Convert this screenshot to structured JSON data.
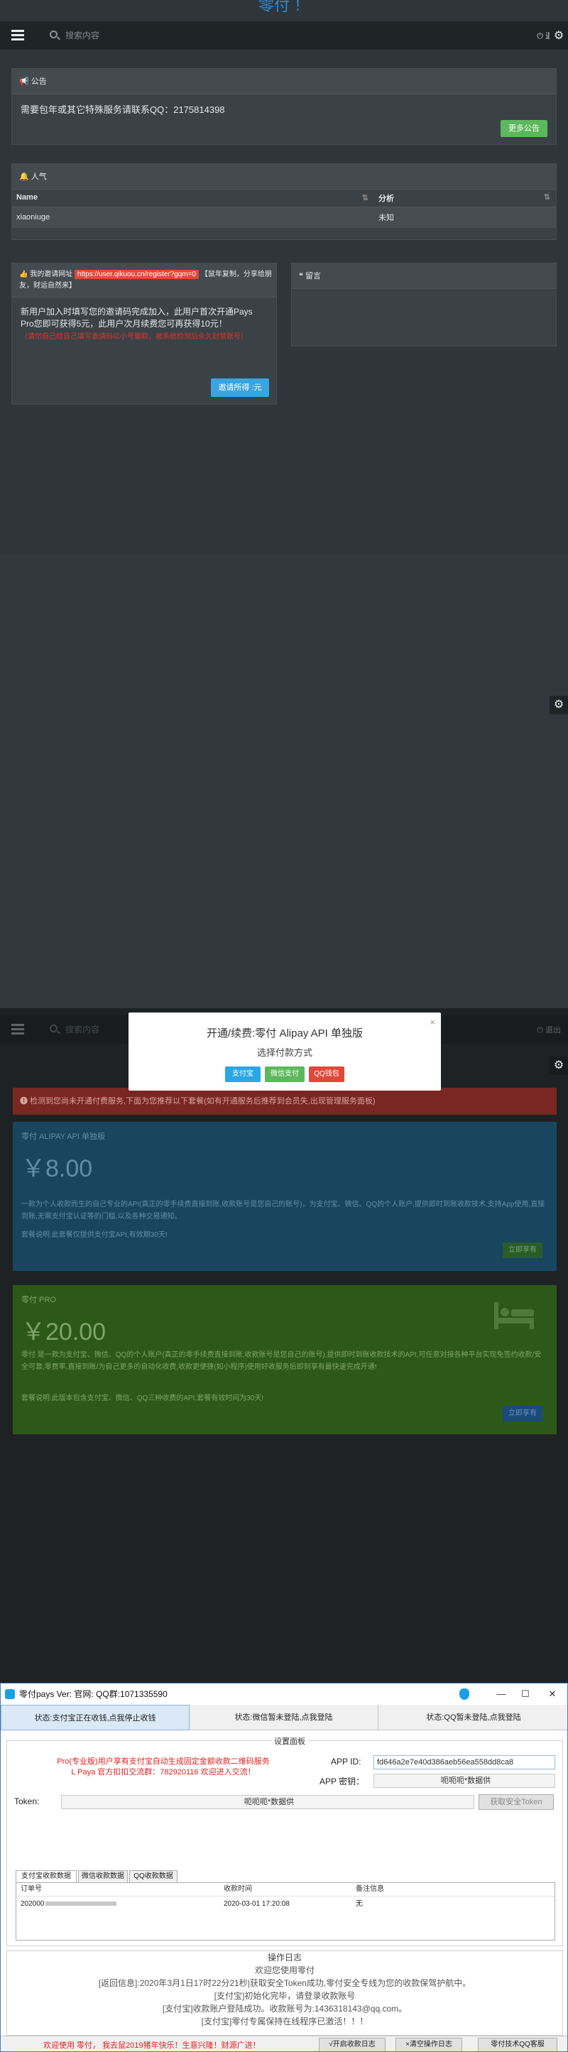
{
  "dashboard": {
    "brand": "零付 ！",
    "search_placeholder": "搜索内容",
    "logout": "退出",
    "announcement": {
      "title": "公告",
      "text": "需要包年或其它特殊服务请联系QQ：2175814398",
      "more_button": "更多公告"
    },
    "popularity": {
      "title": "人气",
      "headers": [
        "Name",
        "分析"
      ],
      "rows": [
        [
          "xiaoniuge",
          "未知"
        ]
      ]
    },
    "invite": {
      "label": "我的邀请网址",
      "url": "https://user.qikuou.cn/register?gqm=0",
      "url_suffix": "【鼠年复制，分享给朋友，财运自然来】",
      "body": "新用户加入时填写您的邀请码完成加入，此用户首次开通Pays Pro您即可获得5元，此用户次月续费您可再获得10元！",
      "warning": "（请勿自己给自己填写邀请码以小号骗取，被系统检测后永久封禁账号）",
      "button": "邀请所得 :元"
    },
    "message_board": {
      "title": "留言"
    },
    "settings_icon": "gear-icon"
  },
  "purchase": {
    "search_placeholder": "搜索内容",
    "logout": "退出",
    "alert": "检测到您尚未开通付费服务,下面为您推荐以下套餐(如有开通服务后推荐到会员失,出现管理服务面板)",
    "plans": [
      {
        "name": "零付 ALIPAY API 单独版",
        "price": "￥8.00",
        "desc": "一款为个人收款而生的自己专业的API(真正的零手续费直接到账,收款账号是您自己的账号)，为支付宝、微信、QQ的个人账户,提供即时到账收款技术,支持App使用,直接到账,无需支付宝认证等的门槛,以及各种交易通知。",
        "note": "套餐说明:此套餐仅提供支付宝API,有效期30天!",
        "button": "立即享有",
        "color": "#1a4f6d"
      },
      {
        "name": "零付 PRO",
        "price": "￥20.00",
        "desc": "零付 是一款为支付宝、微信、QQ的个人账户(真正的零手续费直接到账,收款账号是您自己的账号),提供即时到账收款技术的API,可任意对接各种平台实现免签约收款/安全可靠,零费率,直接到账/为自己更多的自动化收费,收款更便捷(如小程序)使用好收服务后即刻享有最快速完成开通!",
        "note": "套餐说明:此版本包含支付宝、微信、QQ三种收费的API,套餐有效时间为30天!",
        "button": "立即享有",
        "color": "#2e5c16"
      }
    ],
    "modal": {
      "title": "开通/续费:零付 Alipay API 单独版",
      "subtitle": "选择付款方式",
      "close": "×",
      "methods": [
        "支付宝",
        "微信支付",
        "QQ钱包"
      ]
    }
  },
  "app": {
    "title": "零付pays Ver:  官网: QQ群:1071335590",
    "window_controls": [
      "—",
      "☐",
      "✕"
    ],
    "tabs": [
      "状态:支付宝正在收钱,点我停止收钱",
      "状态:微信暂未登陆,点我登陆",
      "状态:QQ暂未登陆,点我登陆"
    ],
    "settings_group": "设置面板",
    "pro_text": "Pro(专业版)用户享有支付宝自动生成固定金额收款二维码服务\nL Paya 官方扣扣交流群：782920116 欢迎进入交流！",
    "app_id_label": "APP ID:",
    "app_id_value": "fd646a2e7e40d386aeb56ea558dd8ca8",
    "app_secret_label": "APP 密钥：",
    "app_secret_value": "呃呃呃*数据供",
    "token_label": "Token:",
    "token_value": "呃呃呃*数据供",
    "token_button": "获取安全Token",
    "subtabs": [
      "支付宝收款数据",
      "微信收款数据",
      "QQ收款数据"
    ],
    "list_headers": [
      "订单号",
      "收款时间",
      "备注信息"
    ],
    "list_rows": [
      [
        "202000",
        "2020-03-01 17:20:08",
        "无"
      ]
    ],
    "log_title": "操作日志",
    "log_lines": [
      "欢迎您使用零付",
      "[返回信息]:2020年3月1日17时22分21秒|获取安全Token成功,零付安全专线为您的收款保驾护航中。",
      "[支付宝]初始化完毕，请登录收款账号",
      "[支付宝]收款账户登陆成功。收款账号为:1436318143@qq.com。",
      "[支付宝]零付专属保持在线程序已激活！！！"
    ],
    "status_text": "欢迎使用 零付，  我去鼠2019猪年快乐！生意兴隆！财源广进！",
    "status_buttons": [
      "√开启收款日志",
      "×清空操作日志",
      "零付技术QQ客服"
    ]
  }
}
